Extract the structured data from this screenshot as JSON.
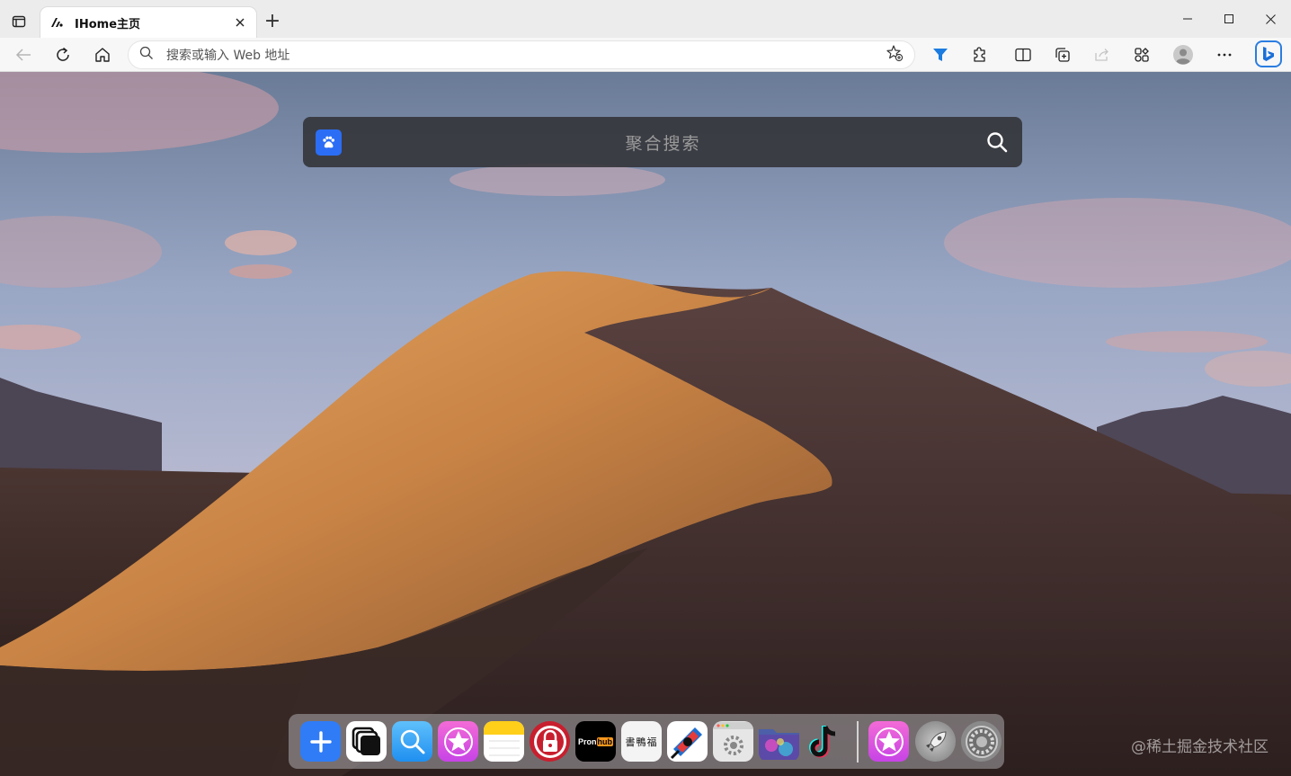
{
  "browser": {
    "tab": {
      "title": "IHome主页",
      "favicon": "ihome-logo"
    },
    "address_placeholder": "搜索或输入 Web 地址",
    "window_controls": {
      "minimize": "─",
      "maximize": "☐",
      "close": "✕"
    },
    "accent": "#2a7de1"
  },
  "page": {
    "search": {
      "placeholder": "聚合搜索",
      "engine": "baidu-paw-icon"
    },
    "dock": {
      "apps": [
        {
          "name": "add",
          "bg": "#2f7cf6"
        },
        {
          "name": "windows",
          "bg": "#ffffff"
        },
        {
          "name": "search",
          "bg": "#3aa4f5"
        },
        {
          "name": "itunes-star",
          "bg": "#e14fe0"
        },
        {
          "name": "notes",
          "bg": "#ffffff"
        },
        {
          "name": "lock",
          "bg": "#c81f2e"
        },
        {
          "name": "pronhub",
          "bg": "#000000",
          "text_left": "Pron",
          "text_right": "hub"
        },
        {
          "name": "calligraphy",
          "bg": "#f4f4f4",
          "text": "書鴨福"
        },
        {
          "name": "game",
          "bg": "#ffffff"
        },
        {
          "name": "settings-window",
          "bg": "#e6e6e6"
        },
        {
          "name": "folder-galaxy",
          "bg": "#5a5aa0"
        },
        {
          "name": "tiktok",
          "bg": "transparent"
        },
        {
          "name": "itunes-star-2",
          "bg": "#e14fe0"
        },
        {
          "name": "launchpad-rocket",
          "bg": "#9a9a9a"
        },
        {
          "name": "system-preferences",
          "bg": "#8a8a8a"
        }
      ]
    },
    "watermark": "@稀土掘金技术社区"
  }
}
